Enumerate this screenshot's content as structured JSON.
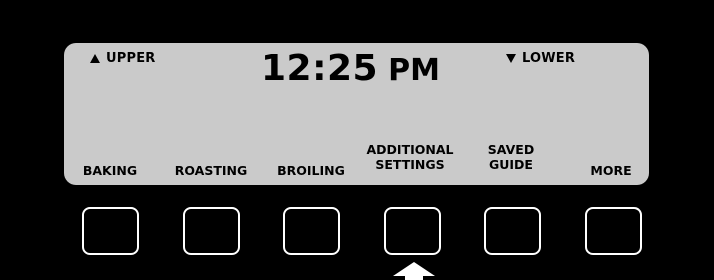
{
  "display": {
    "upper_label": "UPPER",
    "lower_label": "LOWER",
    "time": "12:25",
    "ampm": "PM"
  },
  "softkeys": [
    {
      "label": "BAKING"
    },
    {
      "label": "ROASTING"
    },
    {
      "label": "BROILING"
    },
    {
      "label": "ADDITIONAL\nSETTINGS"
    },
    {
      "label": "SAVED\nGUIDE"
    },
    {
      "label": "MORE"
    }
  ],
  "icons": {
    "upper": "triangle-up-icon",
    "lower": "triangle-down-icon",
    "pointer": "arrow-up-icon"
  },
  "colors": {
    "lcd_background": "#cacaca",
    "panel_background": "#000000",
    "button_border": "#ffffff"
  }
}
